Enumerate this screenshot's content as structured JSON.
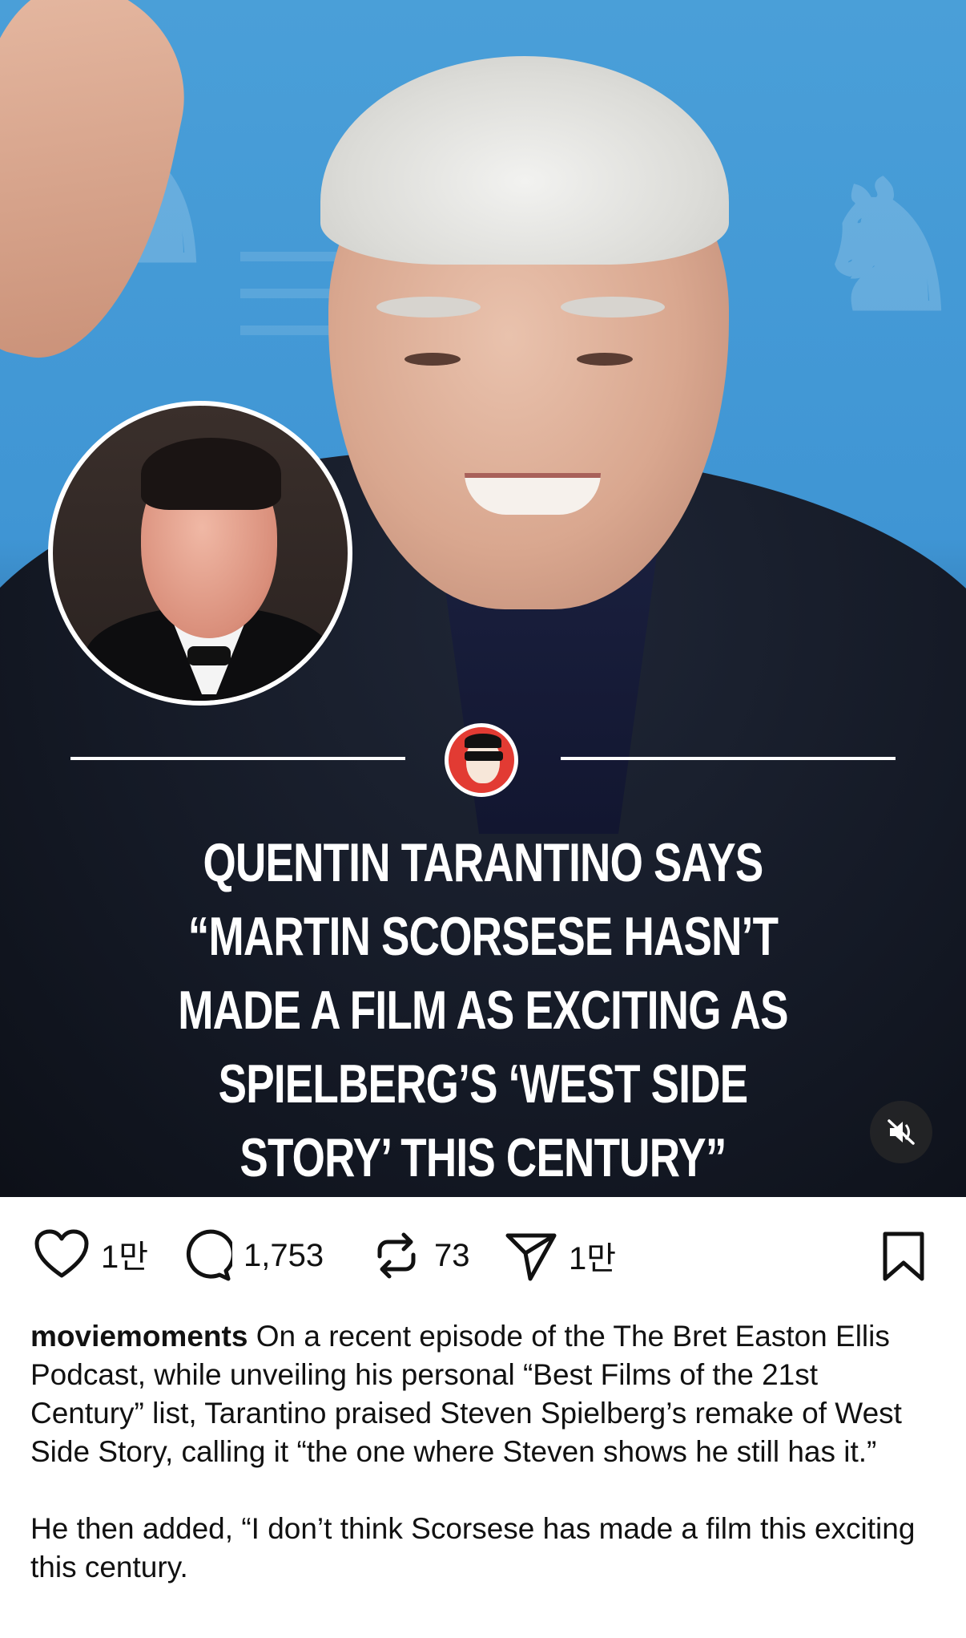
{
  "post": {
    "headline": "QUENTIN TARANTINO SAYS “MARTIN SCORSESE HASN’T MADE A FILM AS EXCITING AS SPIELBERG’S ‘WEST SIDE STORY’ THIS CENTURY”",
    "media_icons": {
      "mute": "speaker-muted-icon",
      "brand_logo": "brand-logo-icon"
    }
  },
  "actions": {
    "likes": "1만",
    "comments": "1,753",
    "reposts": "73",
    "shares": "1만",
    "icons": [
      "heart-icon",
      "comment-icon",
      "repost-icon",
      "share-icon",
      "bookmark-icon"
    ]
  },
  "caption": {
    "username": "moviemoments",
    "text": "On a recent episode of the The Bret Easton Ellis Podcast, while unveiling his personal “Best Films of the 21st Century” list, Tarantino praised Steven Spielberg’s remake of West Side Story, calling it “the one where Steven shows he still has it.”",
    "text2": "He then added, “I don’t think Scorsese has made a film this exciting this century."
  },
  "colors": {
    "background": "#ffffff",
    "headline": "#ffffff",
    "brand_logo": "#e23b33"
  }
}
